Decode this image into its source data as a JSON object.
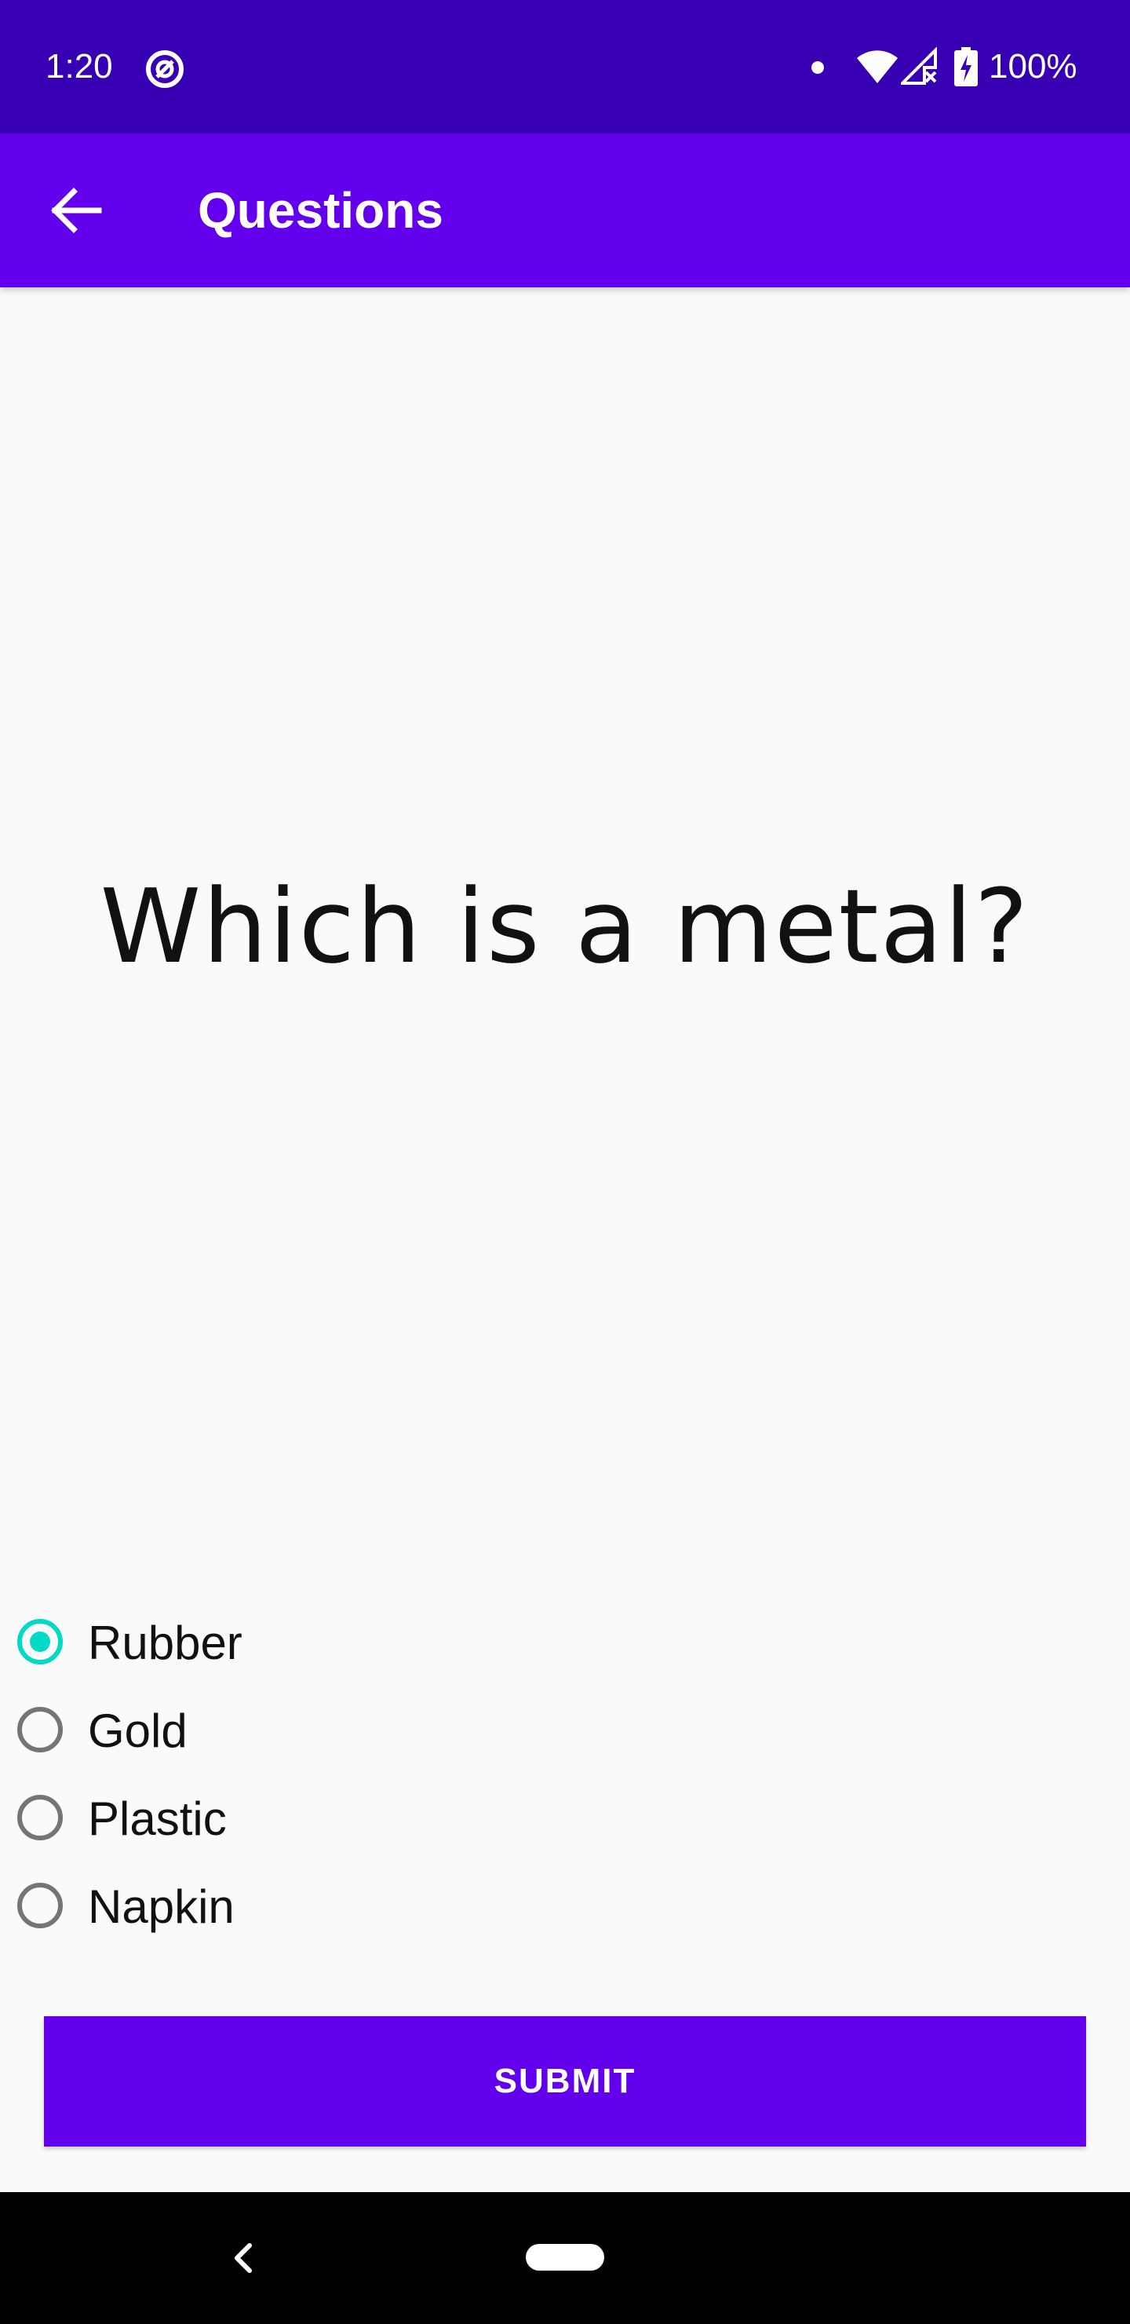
{
  "status_bar": {
    "time": "1:20",
    "battery": "100%",
    "icons": [
      "do-not-disturb-icon",
      "notification-dot-icon",
      "wifi-icon",
      "signal-icon",
      "battery-charging-icon"
    ]
  },
  "app_bar": {
    "title": "Questions",
    "back_icon": "arrow-left-icon"
  },
  "question": {
    "text": "Which is a metal?"
  },
  "options": [
    {
      "label": "Rubber",
      "checked": true
    },
    {
      "label": "Gold",
      "checked": false
    },
    {
      "label": "Plastic",
      "checked": false
    },
    {
      "label": "Napkin",
      "checked": false
    }
  ],
  "submit": {
    "label": "SUBMIT"
  },
  "nav_bar": {
    "back_icon": "chevron-left-icon",
    "home_icon": "home-pill-icon"
  },
  "colors": {
    "status_bar": "#3700b3",
    "primary": "#6200ee",
    "accent": "#03dac5",
    "background": "#fafafa"
  }
}
